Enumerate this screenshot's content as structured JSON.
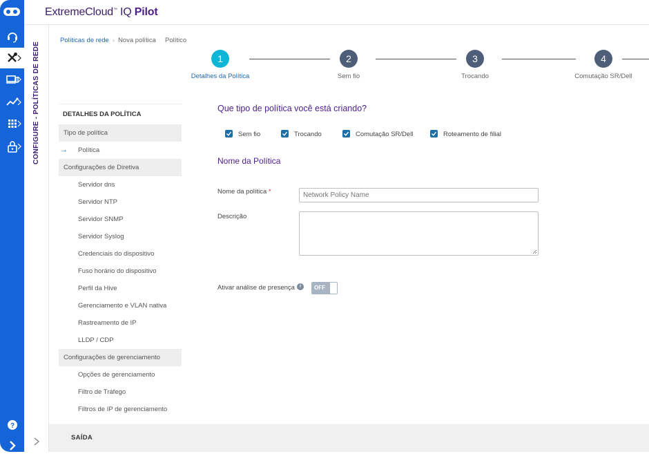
{
  "app": {
    "brand_main": "ExtremeCloud",
    "brand_tm": "™",
    "brand_iq": " IQ ",
    "brand_pilot": "Pilot"
  },
  "rail": {
    "items": [
      {
        "icon": "headset-icon",
        "active": false
      },
      {
        "icon": "tools-icon",
        "active": true
      },
      {
        "icon": "devices-icon",
        "active": false
      },
      {
        "icon": "analytics-icon",
        "active": false
      },
      {
        "icon": "apps-grid-icon",
        "active": false
      },
      {
        "icon": "lock-icon",
        "active": false
      }
    ],
    "help_icon": "help-icon",
    "expand_icon": "chevron-right-icon"
  },
  "section_label": "CONFIGURE - POLÍTICAS DE REDE",
  "breadcrumb": {
    "items": [
      "Políticas de rede",
      "Nova política",
      "Político"
    ]
  },
  "stepper": {
    "steps": [
      {
        "number": "1",
        "label": "Detalhes da Política",
        "active": true
      },
      {
        "number": "2",
        "label": "Sem fio",
        "active": false
      },
      {
        "number": "3",
        "label": "Trocando",
        "active": false
      },
      {
        "number": "4",
        "label": "Comutação SR/Dell",
        "active": false
      }
    ]
  },
  "sidenav": {
    "heading": "DETALHES DA POLÍTICA",
    "groups": [
      {
        "label": "Tipo de política",
        "items": [
          "Política"
        ]
      },
      {
        "label": "Configurações de Diretiva",
        "items": [
          "Servidor dns",
          "Servidor NTP",
          "Servidor SNMP",
          "Servidor Syslog",
          "Credenciais do dispositivo",
          "Fuso horário do dispositivo",
          "Perfil da Hive",
          "Gerenciamento e VLAN nativa",
          "Rastreamento de IP",
          "LLDP / CDP"
        ]
      },
      {
        "label": "Configurações de gerenciamento",
        "items": [
          "Opções de gerenciamento",
          "Filtro de Tráfego",
          "Filtros de IP de gerenciamento"
        ]
      }
    ],
    "current_arrow": "→"
  },
  "form": {
    "question": "Que tipo de política você está criando?",
    "types": [
      {
        "label": "Sem fio",
        "checked": true
      },
      {
        "label": "Trocando",
        "checked": true
      },
      {
        "label": "Comutação SR/Dell",
        "checked": true
      },
      {
        "label": "Roteamento de filial",
        "checked": true
      }
    ],
    "name_section_title": "Nome da Política",
    "name_label": "Nome da política",
    "required_mark": "*",
    "name_placeholder": "Network Policy Name",
    "name_value": "",
    "description_label": "Descrição",
    "presence_label": "Ativar análise de presença",
    "presence_info_icon": "i",
    "presence_toggle": "OFF"
  },
  "footer": {
    "exit_label": "SAÍDA"
  },
  "colors": {
    "rail": "#1565d8",
    "brand": "#4a1f8a",
    "active_step": "#0fb5d6",
    "inactive_step": "#4e5d78",
    "checkbox": "#1e6fa8",
    "toggle_off": "#a9b4c3"
  }
}
